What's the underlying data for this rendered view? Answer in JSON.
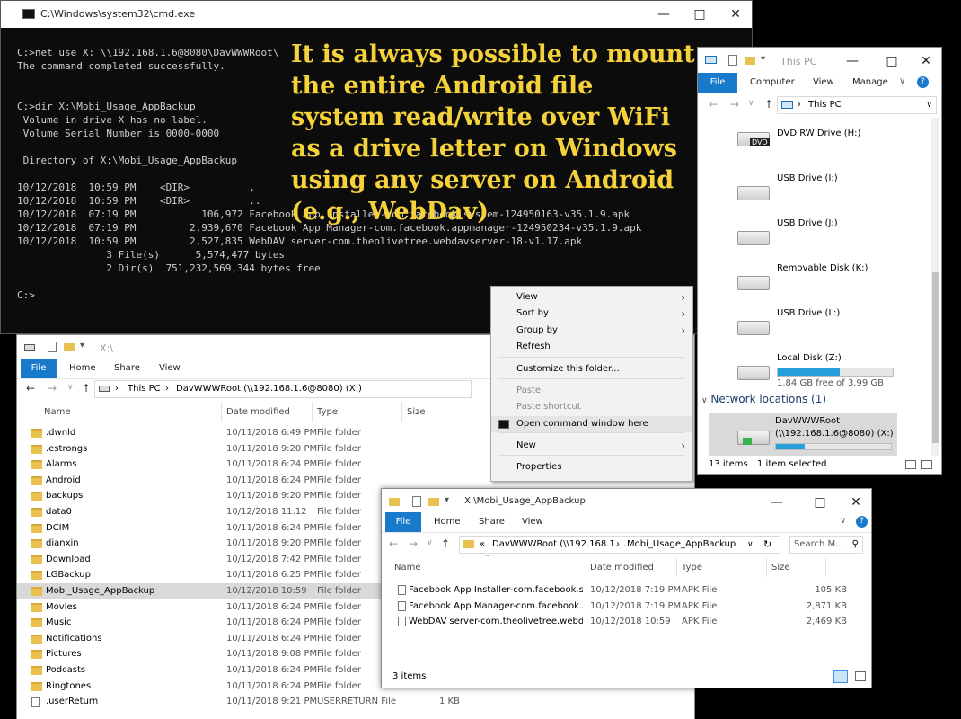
{
  "cmd": {
    "title": "C:\\Windows\\system32\\cmd.exe",
    "lines": [
      "C:>net use X: \\\\192.168.1.6@8080\\DavWWWRoot\\",
      "The command completed successfully.",
      "",
      "",
      "C:>dir X:\\Mobi_Usage_AppBackup",
      " Volume in drive X has no label.",
      " Volume Serial Number is 0000-0000",
      "",
      " Directory of X:\\Mobi_Usage_AppBackup",
      "",
      "10/12/2018  10:59 PM    <DIR>          .",
      "10/12/2018  10:59 PM    <DIR>          ..",
      "10/12/2018  07:19 PM           106,972 Facebook App Installer-com.facebook.system-124950163-v35.1.9.apk",
      "10/12/2018  07:19 PM         2,939,670 Facebook App Manager-com.facebook.appmanager-124950234-v35.1.9.apk",
      "10/12/2018  10:59 PM         2,527,835 WebDAV server-com.theolivetree.webdavserver-18-v1.17.apk",
      "               3 File(s)      5,574,477 bytes",
      "               2 Dir(s)  751,232,569,344 bytes free",
      "",
      "C:>"
    ]
  },
  "caption": "It is always possible to mount the entire Android file system read/write over WiFi as a drive letter on Windows using any server on Android (e.g., WebDav)",
  "this_pc": {
    "title": "This PC",
    "tabs": [
      "File",
      "Computer",
      "View",
      "Manage"
    ],
    "address": "This PC",
    "drives": [
      {
        "name": "DVD RW Drive (H:)",
        "sub": "",
        "badge": "DVD"
      },
      {
        "name": "USB Drive (I:)",
        "sub": ""
      },
      {
        "name": "USB Drive (J:)",
        "sub": ""
      },
      {
        "name": "Removable Disk (K:)",
        "sub": ""
      },
      {
        "name": "USB Drive (L:)",
        "sub": ""
      },
      {
        "name": "Local Disk (Z:)",
        "sub": "1.84 GB free of 3.99 GB",
        "usage": 0.54
      }
    ],
    "network_header": "Network locations (1)",
    "network": {
      "name": "DavWWWRoot",
      "sub": "(\\\\192.168.1.6@8080) (X:)",
      "usage": 0.25
    },
    "status_items": "13 items",
    "status_selected": "1 item selected"
  },
  "explorer_x": {
    "title": "X:\\",
    "tabs": [
      "File",
      "Home",
      "Share",
      "View"
    ],
    "address": [
      "This PC",
      "DavWWWRoot (\\\\192.168.1.6@8080) (X:)"
    ],
    "columns": [
      "Name",
      "Date modified",
      "Type",
      "Size"
    ],
    "rows": [
      {
        "name": ".dwnld",
        "date": "10/11/2018 6:49 PM",
        "type": "File folder",
        "size": ""
      },
      {
        "name": ".estrongs",
        "date": "10/11/2018 9:20 PM",
        "type": "File folder",
        "size": ""
      },
      {
        "name": "Alarms",
        "date": "10/11/2018 6:24 PM",
        "type": "File folder",
        "size": ""
      },
      {
        "name": "Android",
        "date": "10/11/2018 6:24 PM",
        "type": "File folder",
        "size": ""
      },
      {
        "name": "backups",
        "date": "10/11/2018 9:20 PM",
        "type": "File folder",
        "size": ""
      },
      {
        "name": "data0",
        "date": "10/12/2018 11:12",
        "type": "File folder",
        "size": ""
      },
      {
        "name": "DCIM",
        "date": "10/11/2018 6:24 PM",
        "type": "File folder",
        "size": ""
      },
      {
        "name": "dianxin",
        "date": "10/11/2018 9:20 PM",
        "type": "File folder",
        "size": ""
      },
      {
        "name": "Download",
        "date": "10/12/2018 7:42 PM",
        "type": "File folder",
        "size": ""
      },
      {
        "name": "LGBackup",
        "date": "10/11/2018 6:25 PM",
        "type": "File folder",
        "size": ""
      },
      {
        "name": "Mobi_Usage_AppBackup",
        "date": "10/12/2018 10:59",
        "type": "File folder",
        "size": "",
        "selected": true
      },
      {
        "name": "Movies",
        "date": "10/11/2018 6:24 PM",
        "type": "File folder",
        "size": ""
      },
      {
        "name": "Music",
        "date": "10/11/2018 6:24 PM",
        "type": "File folder",
        "size": ""
      },
      {
        "name": "Notifications",
        "date": "10/11/2018 6:24 PM",
        "type": "File folder",
        "size": ""
      },
      {
        "name": "Pictures",
        "date": "10/11/2018 9:08 PM",
        "type": "File folder",
        "size": ""
      },
      {
        "name": "Podcasts",
        "date": "10/11/2018 6:24 PM",
        "type": "File folder",
        "size": ""
      },
      {
        "name": "Ringtones",
        "date": "10/11/2018 6:24 PM",
        "type": "File folder",
        "size": ""
      },
      {
        "name": ".userReturn",
        "date": "10/11/2018 9:21 PM",
        "type": "USERRETURN File",
        "size": "1 KB",
        "file": true
      }
    ]
  },
  "context_menu": {
    "items": [
      {
        "label": "View",
        "arrow": true
      },
      {
        "label": "Sort by",
        "arrow": true
      },
      {
        "label": "Group by",
        "arrow": true
      },
      {
        "label": "Refresh",
        "arrow": false
      },
      {
        "label": "Customize this folder...",
        "arrow": false
      },
      {
        "label": "Paste",
        "arrow": false,
        "disabled": true
      },
      {
        "label": "Paste shortcut",
        "arrow": false,
        "disabled": true
      },
      {
        "label": "Open command window here",
        "arrow": false,
        "highlight": true
      },
      {
        "label": "New",
        "arrow": true
      },
      {
        "label": "Properties",
        "arrow": false
      }
    ]
  },
  "explorer_app": {
    "title": "X:\\Mobi_Usage_AppBackup",
    "tabs": [
      "File",
      "Home",
      "Share",
      "View"
    ],
    "address": [
      "«",
      "DavWWWRoot (\\\\192.168.1....",
      "Mobi_Usage_AppBackup"
    ],
    "search_placeholder": "Search M...",
    "columns": [
      "Name",
      "Date modified",
      "Type",
      "Size"
    ],
    "rows": [
      {
        "name": "Facebook App Installer-com.facebook.sy...",
        "date": "10/12/2018 7:19 PM",
        "type": "APK File",
        "size": "105 KB"
      },
      {
        "name": "Facebook App Manager-com.facebook.a...",
        "date": "10/12/2018 7:19 PM",
        "type": "APK File",
        "size": "2,871 KB"
      },
      {
        "name": "WebDAV server-com.theolivetree.webda...",
        "date": "10/12/2018 10:59",
        "type": "APK File",
        "size": "2,469 KB"
      }
    ],
    "status_items": "3 items"
  }
}
